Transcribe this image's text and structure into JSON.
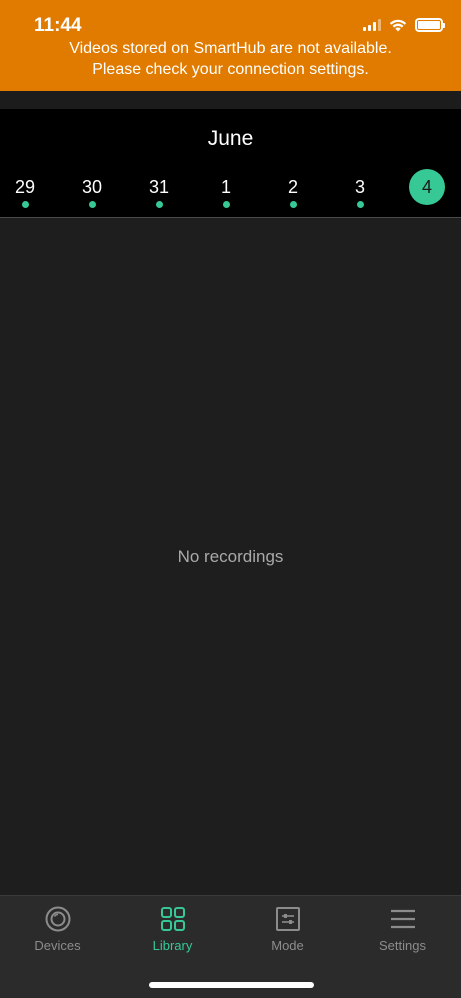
{
  "status_bar": {
    "time": "11:44"
  },
  "banner": {
    "line1": "Videos stored on SmartHub are not available.",
    "line2": "Please check your connection settings.",
    "color": "#e07b00"
  },
  "calendar": {
    "month": "June",
    "days": [
      {
        "label": "29",
        "has_recording": true,
        "selected": false
      },
      {
        "label": "30",
        "has_recording": true,
        "selected": false
      },
      {
        "label": "31",
        "has_recording": true,
        "selected": false
      },
      {
        "label": "1",
        "has_recording": true,
        "selected": false
      },
      {
        "label": "2",
        "has_recording": true,
        "selected": false
      },
      {
        "label": "3",
        "has_recording": true,
        "selected": false
      },
      {
        "label": "4",
        "has_recording": false,
        "selected": true
      }
    ],
    "accent_color": "#36c995"
  },
  "content": {
    "empty_message": "No recordings"
  },
  "tabbar": {
    "tabs": [
      {
        "label": "Devices",
        "icon": "devices-icon",
        "active": false
      },
      {
        "label": "Library",
        "icon": "library-icon",
        "active": true
      },
      {
        "label": "Mode",
        "icon": "mode-icon",
        "active": false
      },
      {
        "label": "Settings",
        "icon": "settings-icon",
        "active": false
      }
    ]
  }
}
